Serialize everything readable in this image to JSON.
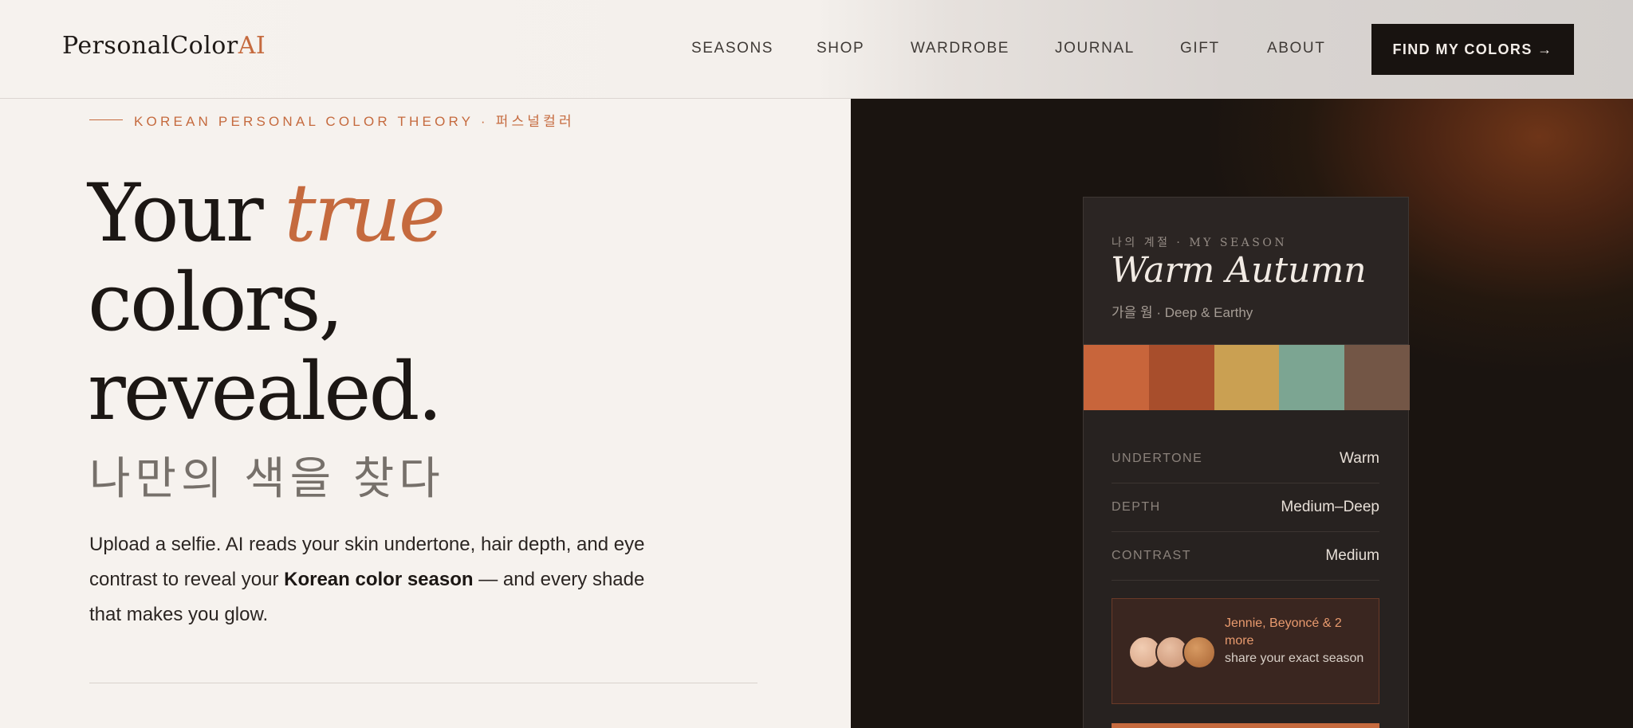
{
  "header": {
    "logo_main": "PersonalColor",
    "logo_accent": "AI",
    "nav": [
      "SEASONS",
      "SHOP",
      "WARDROBE",
      "JOURNAL",
      "GIFT",
      "ABOUT"
    ],
    "cta_label": "FIND MY COLORS →"
  },
  "hero": {
    "eyebrow": "KOREAN PERSONAL COLOR THEORY · 퍼스널컬러",
    "headline_1": "Your ",
    "headline_accent": "true",
    "headline_2": "colors,",
    "headline_3": "revealed.",
    "korean_headline": "나만의 색을 찾다",
    "desc_1": "Upload a selfie. AI reads your skin undertone, hair depth, and eye contrast to reveal your ",
    "desc_bold": "Korean color season",
    "desc_2": " — and every shade that makes you glow."
  },
  "card": {
    "kicker": "나의 계절 · MY SEASON",
    "season_name": "Warm Autumn",
    "season_sub": "가을 웜 · Deep & Earthy",
    "swatches": [
      "#c8653b",
      "#a84e2c",
      "#caa052",
      "#7ca592",
      "#735646"
    ],
    "attributes": [
      {
        "label": "UNDERTONE",
        "value": "Warm"
      },
      {
        "label": "DEPTH",
        "value": "Medium–Deep"
      },
      {
        "label": "CONTRAST",
        "value": "Medium"
      }
    ],
    "celeb_names": "Jennie, Beyoncé & 2 more",
    "celeb_sub": "share your exact season"
  },
  "colors": {
    "accent": "#c56a3e",
    "dark": "#1a1410",
    "cream": "#f6f2ee"
  }
}
